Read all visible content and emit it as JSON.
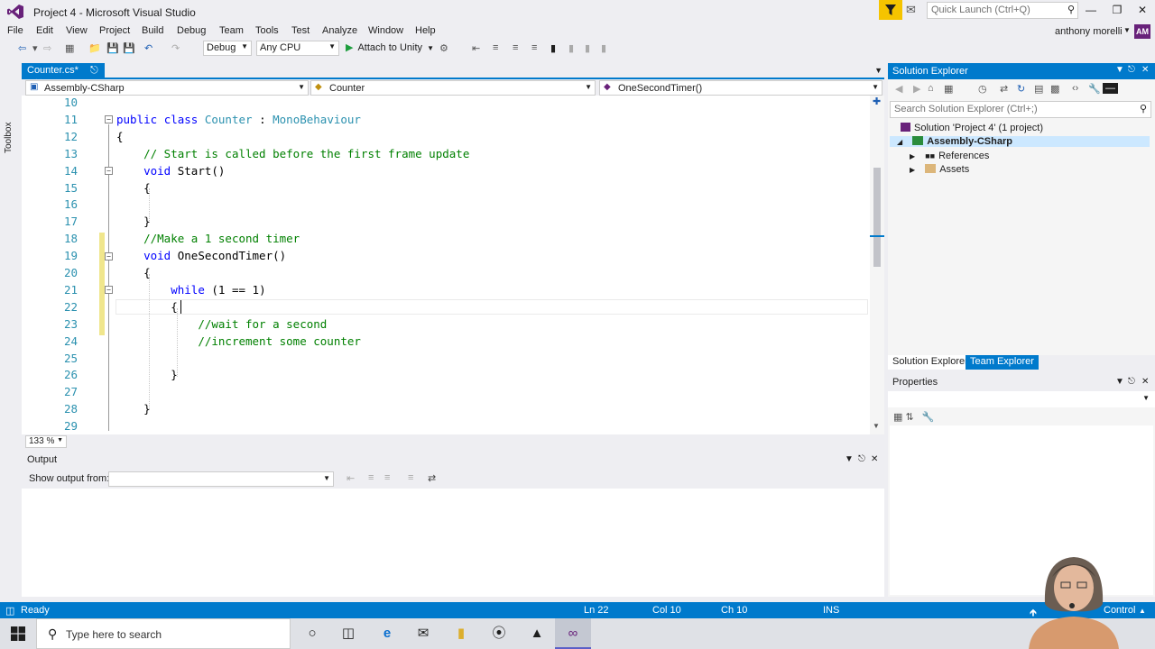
{
  "window": {
    "title": "Project 4 - Microsoft Visual Studio",
    "quick_launch_placeholder": "Quick Launch (Ctrl+Q)"
  },
  "menu": [
    "File",
    "Edit",
    "View",
    "Project",
    "Build",
    "Debug",
    "Team",
    "Tools",
    "Test",
    "Analyze",
    "Window",
    "Help"
  ],
  "user": {
    "name": "anthony morelli",
    "initials": "AM"
  },
  "toolbar": {
    "configuration": "Debug",
    "platform": "Any CPU",
    "attach_label": "Attach to Unity"
  },
  "left_strip": {
    "toolbox_label": "Toolbox"
  },
  "editor": {
    "tab_label": "Counter.cs*",
    "nav": {
      "project": "Assembly-CSharp",
      "type": "Counter",
      "member": "OneSecondTimer()"
    },
    "zoom": "133 %",
    "lines": [
      {
        "n": "10",
        "html": ""
      },
      {
        "n": "11",
        "html": "<span class=\"kw\">public</span> <span class=\"kw\">class</span> <span class=\"ty\">Counter</span> : <span class=\"ty\">MonoBehaviour</span>"
      },
      {
        "n": "12",
        "html": "{"
      },
      {
        "n": "13",
        "html": "    <span class=\"cm\">// Start is called before the first frame update</span>"
      },
      {
        "n": "14",
        "html": "    <span class=\"kw\">void</span> Start()"
      },
      {
        "n": "15",
        "html": "    {"
      },
      {
        "n": "16",
        "html": ""
      },
      {
        "n": "17",
        "html": "    }"
      },
      {
        "n": "18",
        "html": "    <span class=\"cm\">//Make a 1 second timer</span>"
      },
      {
        "n": "19",
        "html": "    <span class=\"kw\">void</span> OneSecondTimer()"
      },
      {
        "n": "20",
        "html": "    {"
      },
      {
        "n": "21",
        "html": "        <span class=\"kw\">while</span> (1 == 1)"
      },
      {
        "n": "22",
        "html": "        {"
      },
      {
        "n": "23",
        "html": "            <span class=\"cm\">//wait for a second</span>"
      },
      {
        "n": "24",
        "html": "            <span class=\"cm\">//increment some counter</span>"
      },
      {
        "n": "25",
        "html": ""
      },
      {
        "n": "26",
        "html": "        }"
      },
      {
        "n": "27",
        "html": ""
      },
      {
        "n": "28",
        "html": "    }"
      },
      {
        "n": "29",
        "html": ""
      }
    ]
  },
  "output": {
    "title": "Output",
    "show_from_label": "Show output from:"
  },
  "solution_explorer": {
    "title": "Solution Explorer",
    "search_placeholder": "Search Solution Explorer (Ctrl+;)",
    "solution": "Solution 'Project 4' (1 project)",
    "project": "Assembly-CSharp",
    "items": [
      "References",
      "Assets"
    ],
    "tabs": [
      "Solution Explorer",
      "Team Explorer"
    ]
  },
  "properties": {
    "title": "Properties"
  },
  "status": {
    "ready": "Ready",
    "ln": "Ln 22",
    "col": "Col 10",
    "ch": "Ch 10",
    "mode": "INS",
    "control": "Control"
  },
  "taskbar": {
    "search_placeholder": "Type here to search"
  },
  "colors": {
    "accent": "#007acc",
    "vs_purple": "#68217a",
    "keyword": "#0000ff",
    "type": "#2b91af",
    "comment": "#008000"
  }
}
